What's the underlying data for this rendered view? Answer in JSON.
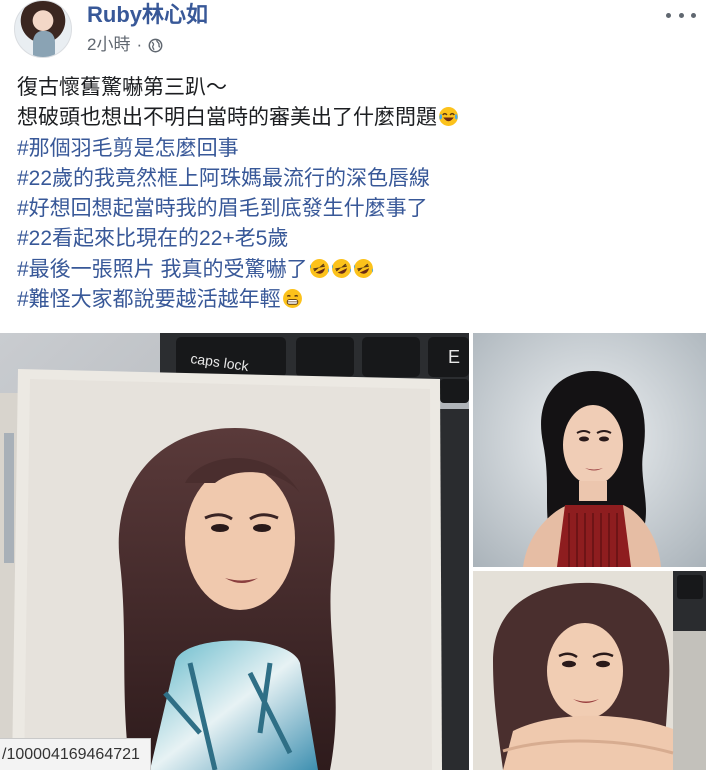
{
  "post": {
    "author_name": "Ruby林心如",
    "timestamp": "2小時",
    "separator": "·",
    "privacy_icon": "globe-icon",
    "more_icon": "more-options-icon",
    "text_lines": [
      {
        "text": "復古懷舊驚嚇第三趴～",
        "hashtag": false,
        "emoji": ""
      },
      {
        "text": "想破頭也想出不明白當時的審美出了什麼問題",
        "hashtag": false,
        "emoji": "tears-of-joy"
      },
      {
        "text": "#那個羽毛剪是怎麼回事",
        "hashtag": true,
        "emoji": ""
      },
      {
        "text": "#22歲的我竟然框上阿珠媽最流行的深色唇線",
        "hashtag": true,
        "emoji": ""
      },
      {
        "text": "#好想回想起當時我的眉毛到底發生什麼事了",
        "hashtag": true,
        "emoji": ""
      },
      {
        "text": "#22看起來比現在的22+老5歲",
        "hashtag": true,
        "emoji": ""
      },
      {
        "text": "#最後一張照片 我真的受驚嚇了",
        "hashtag": true,
        "emoji": "rofl-x3"
      },
      {
        "text": "#難怪大家都說要越活越年輕",
        "hashtag": true,
        "emoji": "grin-sweat"
      }
    ]
  },
  "photos": [
    {
      "name": "photo-keyboard-portrait",
      "description_icon": "photo"
    },
    {
      "name": "photo-red-top-portrait",
      "description_icon": "photo"
    },
    {
      "name": "photo-chin-rest-portrait",
      "description_icon": "photo"
    }
  ],
  "status_bar": {
    "url_text": "/100004169464721"
  },
  "colors": {
    "link_blue": "#385898",
    "text": "#1c1e21",
    "meta_gray": "#606770"
  }
}
